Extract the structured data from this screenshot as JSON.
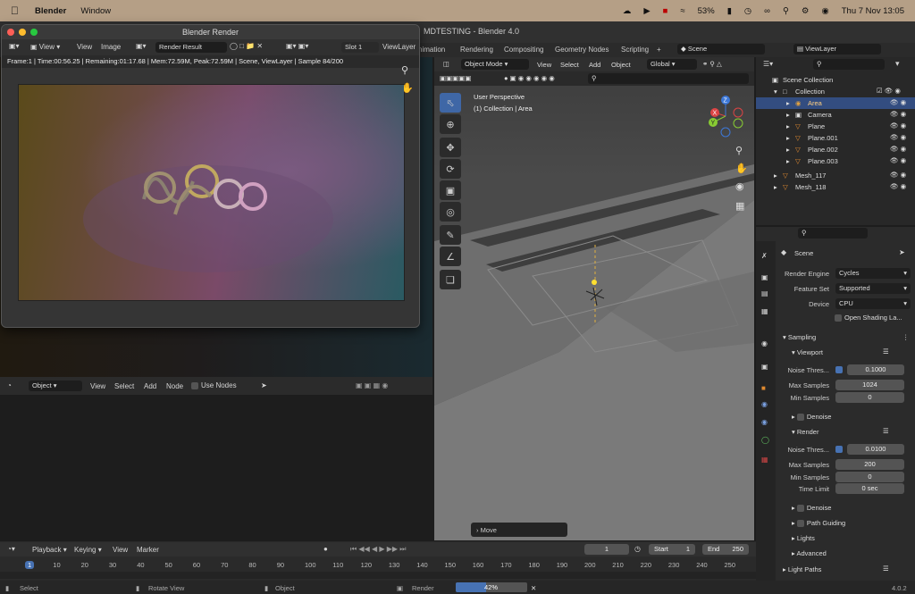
{
  "menubar": {
    "app": "Blender",
    "menu": "Window",
    "battery": "53%",
    "datetime": "Thu 7 Nov  13:05"
  },
  "window_title": "MDTESTING - Blender 4.0",
  "workspaces": [
    "nimation",
    "Rendering",
    "Compositing",
    "Geometry Nodes",
    "Scripting",
    "+"
  ],
  "topbar": {
    "scene": "Scene",
    "viewlayer": "ViewLayer"
  },
  "render_window": {
    "title": "Blender Render",
    "menus": [
      "View",
      "View",
      "Image"
    ],
    "image_name": "Render Result",
    "slot": "Slot 1",
    "viewlayer": "ViewLayer",
    "info": "Frame:1 | Time:00:56.25 | Remaining:01:17.68 | Mem:72.59M, Peak:72.59M | Scene, ViewLayer | Sample 84/200"
  },
  "viewport": {
    "mode": "Object Mode",
    "menus": [
      "View",
      "Select",
      "Add",
      "Object"
    ],
    "orientation": "Global",
    "overlay_title": "User Perspective",
    "overlay_sub": "(1) Collection | Area",
    "operator_panel": "Move",
    "gizmo": {
      "x": "X",
      "y": "Y",
      "z": "Z"
    }
  },
  "node_editor": {
    "type": "Object",
    "menus": [
      "View",
      "Select",
      "Add",
      "Node"
    ],
    "use_nodes": "Use Nodes"
  },
  "outliner": {
    "items": [
      {
        "label": "Scene Collection",
        "indent": 0
      },
      {
        "label": "Collection",
        "indent": 1
      },
      {
        "label": "Area",
        "indent": 2,
        "selected": true
      },
      {
        "label": "Camera",
        "indent": 2
      },
      {
        "label": "Plane",
        "indent": 2
      },
      {
        "label": "Plane.001",
        "indent": 2
      },
      {
        "label": "Plane.002",
        "indent": 2
      },
      {
        "label": "Plane.003",
        "indent": 2
      },
      {
        "label": "Mesh_117",
        "indent": 1
      },
      {
        "label": "Mesh_118",
        "indent": 1
      }
    ]
  },
  "properties": {
    "context": "Scene",
    "render_engine_label": "Render Engine",
    "render_engine": "Cycles",
    "feature_set_label": "Feature Set",
    "feature_set": "Supported",
    "device_label": "Device",
    "device": "CPU",
    "osl": "Open Shading La...",
    "sampling": "Sampling",
    "viewport": "Viewport",
    "noise_label": "Noise Thres...",
    "vp_noise": "0.1000",
    "max_samples_label": "Max Samples",
    "vp_max": "1024",
    "min_samples_label": "Min Samples",
    "vp_min": "0",
    "denoise": "Denoise",
    "render": "Render",
    "r_noise": "0.0100",
    "r_max": "200",
    "r_min": "0",
    "time_limit_label": "Time Limit",
    "r_time": "0 sec",
    "denoise2": "Denoise",
    "path_guiding": "Path Guiding",
    "lights": "Lights",
    "advanced": "Advanced",
    "light_paths": "Light Paths"
  },
  "timeline": {
    "menus": [
      "Playback",
      "Keying",
      "View",
      "Marker"
    ],
    "current_frame": "1",
    "start_label": "Start",
    "start": "1",
    "end_label": "End",
    "end": "250",
    "ticks": [
      "1",
      "10",
      "20",
      "30",
      "40",
      "50",
      "60",
      "70",
      "80",
      "90",
      "100",
      "110",
      "120",
      "130",
      "140",
      "150",
      "160",
      "170",
      "180",
      "190",
      "200",
      "210",
      "220",
      "230",
      "240",
      "250"
    ]
  },
  "statusbar": {
    "select": "Select",
    "rotate": "Rotate View",
    "object": "Object",
    "render": "Render",
    "progress": 42,
    "progress_label": "42%",
    "version": "4.0.2"
  }
}
